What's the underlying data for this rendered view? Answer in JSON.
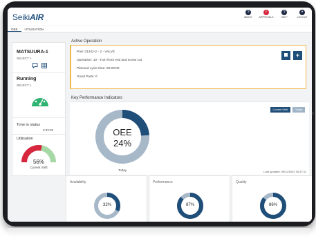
{
  "app": {
    "logo_part1": "Seiki",
    "logo_part2": "AIR"
  },
  "top_nav": [
    {
      "label": "ABOUT",
      "icon": "help-icon"
    },
    {
      "label": "APPROVALS",
      "icon": "bell-icon"
    },
    {
      "label": "HELP",
      "icon": "help-icon"
    },
    {
      "label": "LOGOUT",
      "icon": "user-icon"
    }
  ],
  "tabs": [
    {
      "label": "OEE"
    },
    {
      "label": "UTILISATION"
    }
  ],
  "machine": {
    "name": "MATSUURA-1",
    "select_label": "SELECT >",
    "status": "Running",
    "status_select_label": "SELECT >",
    "time_in_status_label": "Time in status",
    "time_in_status_value": "0:03:09",
    "utilisation_label": "Utilisation",
    "utilisation_value": "56%",
    "utilisation_fraction": 0.56,
    "utilisation_sub": "Current Shift"
  },
  "active_operation": {
    "title": "Active Operation",
    "part": "Part:  01322-2 - 2 - VALVE",
    "operation": "Operation:  10 - Turn front end and screw cut",
    "planned_cycle": "Planned cycle time:  00:23:00",
    "good_parts": "Good Parts:  0"
  },
  "kpi": {
    "title": "Key Performance Indicators",
    "oee_label": "OEE",
    "oee_value": "24%",
    "oee_fraction": 0.24,
    "oee_period": "Today",
    "btn_current_shift": "Current Shift",
    "btn_today": "Today",
    "last_updated": "Last updated: 09/12/2022 16:37:11",
    "availability": {
      "label": "Availability",
      "value": "32%",
      "fraction": 0.32
    },
    "performance": {
      "label": "Performance",
      "value": "87%",
      "fraction": 0.87
    },
    "quality": {
      "label": "Quality",
      "value": "86%",
      "fraction": 0.86
    }
  },
  "colors": {
    "primary": "#1f4e79",
    "donut_track": "#a7b8c9",
    "running": "#2fb371",
    "util_red": "#d7263d",
    "util_green": "#a6d8a6",
    "op_border": "#f0b94a"
  }
}
